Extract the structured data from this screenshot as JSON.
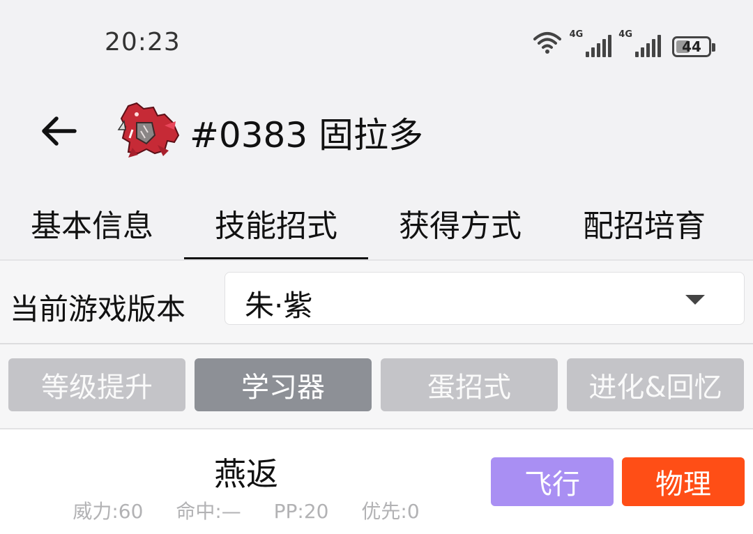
{
  "status_bar": {
    "time": "20:23",
    "network_1": "4G",
    "network_2": "4G",
    "battery": "44",
    "battery_level": 0.44,
    "icons": [
      "wifi-icon",
      "signal-icon",
      "signal-icon",
      "battery-icon"
    ]
  },
  "header": {
    "title": "#0383 固拉多",
    "back_icon": "arrow-left-icon",
    "avatar_icon": "groudon-sprite-icon"
  },
  "tabs": [
    {
      "label": "基本信息",
      "active": false
    },
    {
      "label": "技能招式",
      "active": true
    },
    {
      "label": "获得方式",
      "active": false
    },
    {
      "label": "配招培育",
      "active": false
    }
  ],
  "version": {
    "label": "当前游戏版本",
    "selected": "朱·紫",
    "dropdown_icon": "caret-down-icon"
  },
  "methods": [
    {
      "label": "等级提升",
      "active": false
    },
    {
      "label": "学习器",
      "active": true
    },
    {
      "label": "蛋招式",
      "active": false
    },
    {
      "label": "进化&回忆",
      "active": false
    }
  ],
  "moves": [
    {
      "name": "燕返",
      "power": "威力:60",
      "accuracy": "命中:—",
      "pp": "PP:20",
      "priority": "优先:0",
      "type": "飞行",
      "category": "物理"
    }
  ],
  "colors": {
    "flying_type": "#a98ff3",
    "physical_category": "#ff4e16",
    "method_active": "#8d9096",
    "method_inactive": "#c4c4c8"
  }
}
